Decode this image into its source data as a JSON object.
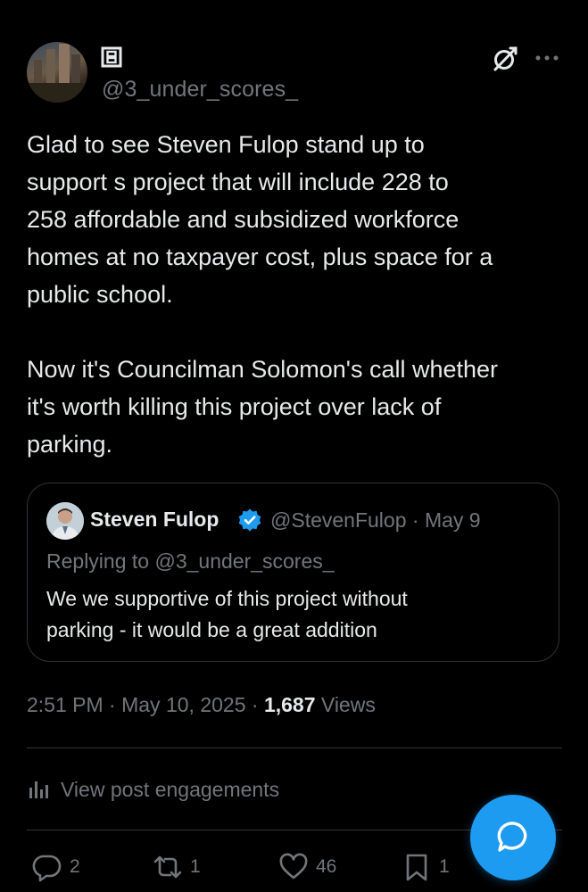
{
  "author": {
    "handle": "@3_under_scores_"
  },
  "tweet": {
    "text": "Glad to see Steven Fulop stand up to\nsupport s project that will include 228 to\n258 affordable and subsidized workforce\nhomes at no taxpayer cost, plus space for a\npublic school.\n\nNow it's Councilman Solomon's call whether\nit's worth killing this project over lack of\nparking."
  },
  "quote": {
    "name": "Steven Fulop",
    "handle": "@StevenFulop",
    "separator": "·",
    "date": "May 9",
    "replying_prefix": "Replying to",
    "replying_handle": "@3_under_scores_",
    "text": "We we supportive of this project without\nparking - it would be a great addition"
  },
  "meta": {
    "time": "2:51 PM",
    "separator": "·",
    "date": "May 10, 2025",
    "views_count": "1,687",
    "views_label": "Views"
  },
  "engagements_label": "View post engagements",
  "actions": {
    "replies": "2",
    "reposts": "1",
    "likes": "46",
    "bookmarks": "1"
  },
  "colors": {
    "background": "#000000",
    "text": "#e7e9ea",
    "muted": "#71767b",
    "accent": "#1d9bf0",
    "border": "#2f3336"
  },
  "icons": {
    "display": "identity-square-icon",
    "grok": "grok-icon",
    "more": "more-dots-icon",
    "verified": "verified-badge-icon",
    "engagements": "bar-chart-icon",
    "reply": "reply-bubble-icon",
    "repost": "repost-icon",
    "like": "heart-icon",
    "bookmark": "bookmark-icon",
    "compose": "chat-bubble-icon"
  }
}
